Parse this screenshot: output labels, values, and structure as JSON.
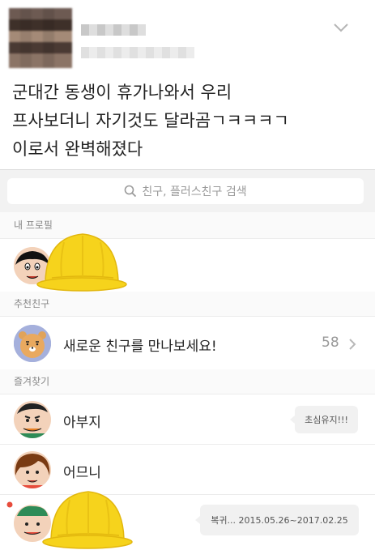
{
  "post": {
    "lines": [
      "군대간 동생이 휴가나와서 우리",
      "프사보더니 자기것도 달라곰ㄱㅋㅋㅋㄱ",
      "이로서 완벽해졌다"
    ]
  },
  "search": {
    "placeholder": "친구, 플러스친구 검색"
  },
  "sections": {
    "my_profile": "내 프로필",
    "recommended": "추천친구",
    "favorites": "즐겨찾기"
  },
  "recommend": {
    "label": "새로운 친구를 만나보세요!",
    "count": "58"
  },
  "favorites": [
    {
      "name": "아부지",
      "status": "초심유지!!!"
    },
    {
      "name": "어므니",
      "status": ""
    },
    {
      "name": "",
      "status": "복귀... 2015.05.26~2017.02.25"
    }
  ],
  "colors": {
    "hat": "#f6d31c",
    "bubble": "#f1f1f1",
    "text_muted": "#888888"
  }
}
